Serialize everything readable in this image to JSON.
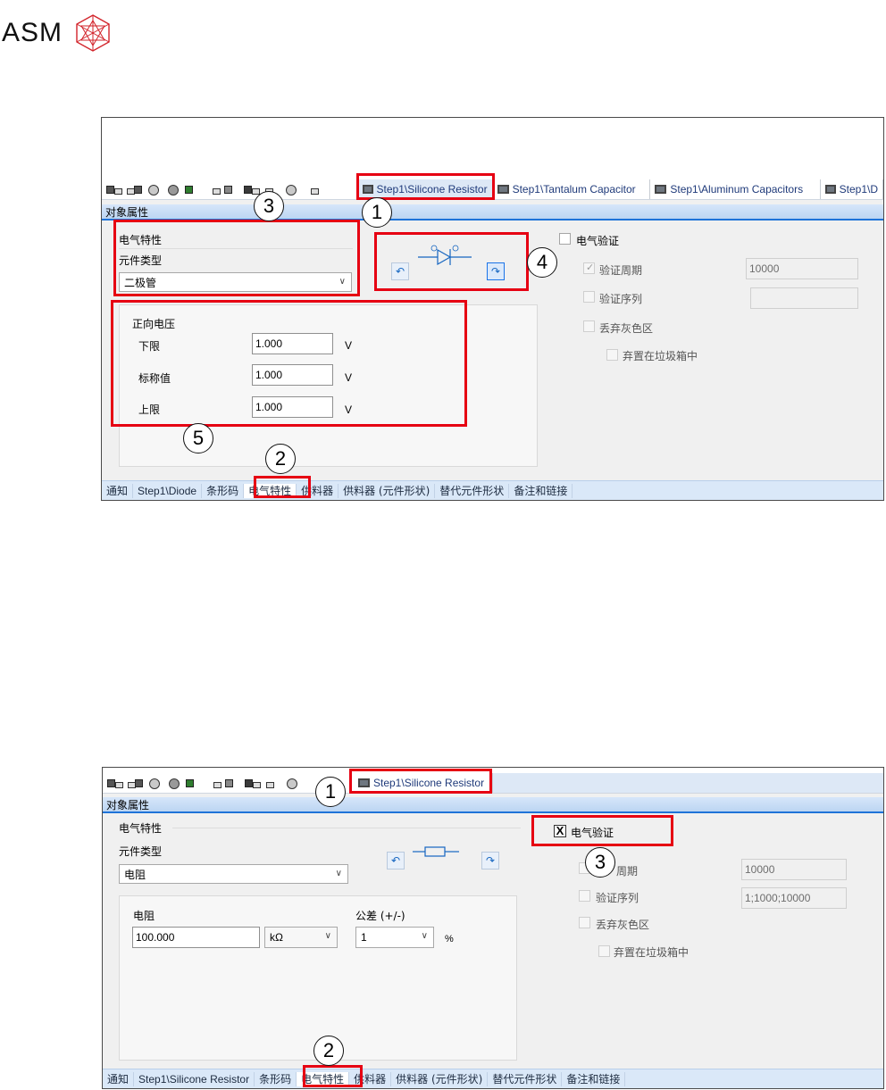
{
  "logo": {
    "text": "ASM"
  },
  "screenshot1": {
    "doc_tabs": [
      "Step1\\Silicone Resistor",
      "Step1\\Tantalum Capacitor",
      "Step1\\Aluminum Capacitors",
      "Step1\\D"
    ],
    "icon_strip": [
      "元",
      "元",
      "件",
      "ji",
      "P",
      "料",
      "器",
      "片",
      "作",
      "图",
      "送"
    ],
    "title": "对象属性",
    "group_label": "电气特性",
    "component_type_label": "元件类型",
    "component_type_value": "二极管",
    "forward_voltage_label": "正向电压",
    "rows": [
      {
        "label": "下限",
        "value": "1.000",
        "unit": "V"
      },
      {
        "label": "标称值",
        "value": "1.000",
        "unit": "V"
      },
      {
        "label": "上限",
        "value": "1.000",
        "unit": "V"
      }
    ],
    "electrical_verification_label": "电气验证",
    "verification_period_label": "验证周期",
    "verification_period_value": "10000",
    "verification_sequence_label": "验证序列",
    "verification_sequence_value": "",
    "discard_gray_label": "丢弃灰色区",
    "place_in_trash_label": "弃置在垃圾箱中",
    "bottom_tabs": [
      "通知",
      "Step1\\Diode",
      "条形码",
      "电气特性",
      "供料器",
      "供料器 (元件形状)",
      "替代元件形状",
      "备注和链接"
    ],
    "callouts": [
      "1",
      "2",
      "3",
      "4",
      "5"
    ]
  },
  "screenshot2": {
    "doc_tabs": [
      "Step1\\Silicone Resistor"
    ],
    "title": "对象属性",
    "group_label": "电气特性",
    "component_type_label": "元件类型",
    "component_type_value": "电阻",
    "resistance_label": "电阻",
    "resistance_value": "100.000",
    "resistance_unit": "kΩ",
    "tolerance_label": "公差 (+/-)",
    "tolerance_value": "1",
    "tolerance_unit": "%",
    "electrical_verification_label": "电气验证",
    "electrical_verification_mark": "X",
    "verification_period_label": "周期",
    "verification_period_value": "10000",
    "verification_sequence_label": "验证序列",
    "verification_sequence_value": "1;1000;10000",
    "discard_gray_label": "丢弃灰色区",
    "place_in_trash_label": "弃置在垃圾箱中",
    "bottom_tabs": [
      "通知",
      "Step1\\Silicone Resistor",
      "条形码",
      "电气特性",
      "供料器",
      "供料器 (元件形状)",
      "替代元件形状",
      "备注和链接"
    ],
    "callouts": [
      "1",
      "2",
      "3"
    ]
  },
  "colors": {
    "highlight": "#e60012",
    "title_accent": "#1e73d8",
    "tab_text": "#1f3a7a"
  }
}
